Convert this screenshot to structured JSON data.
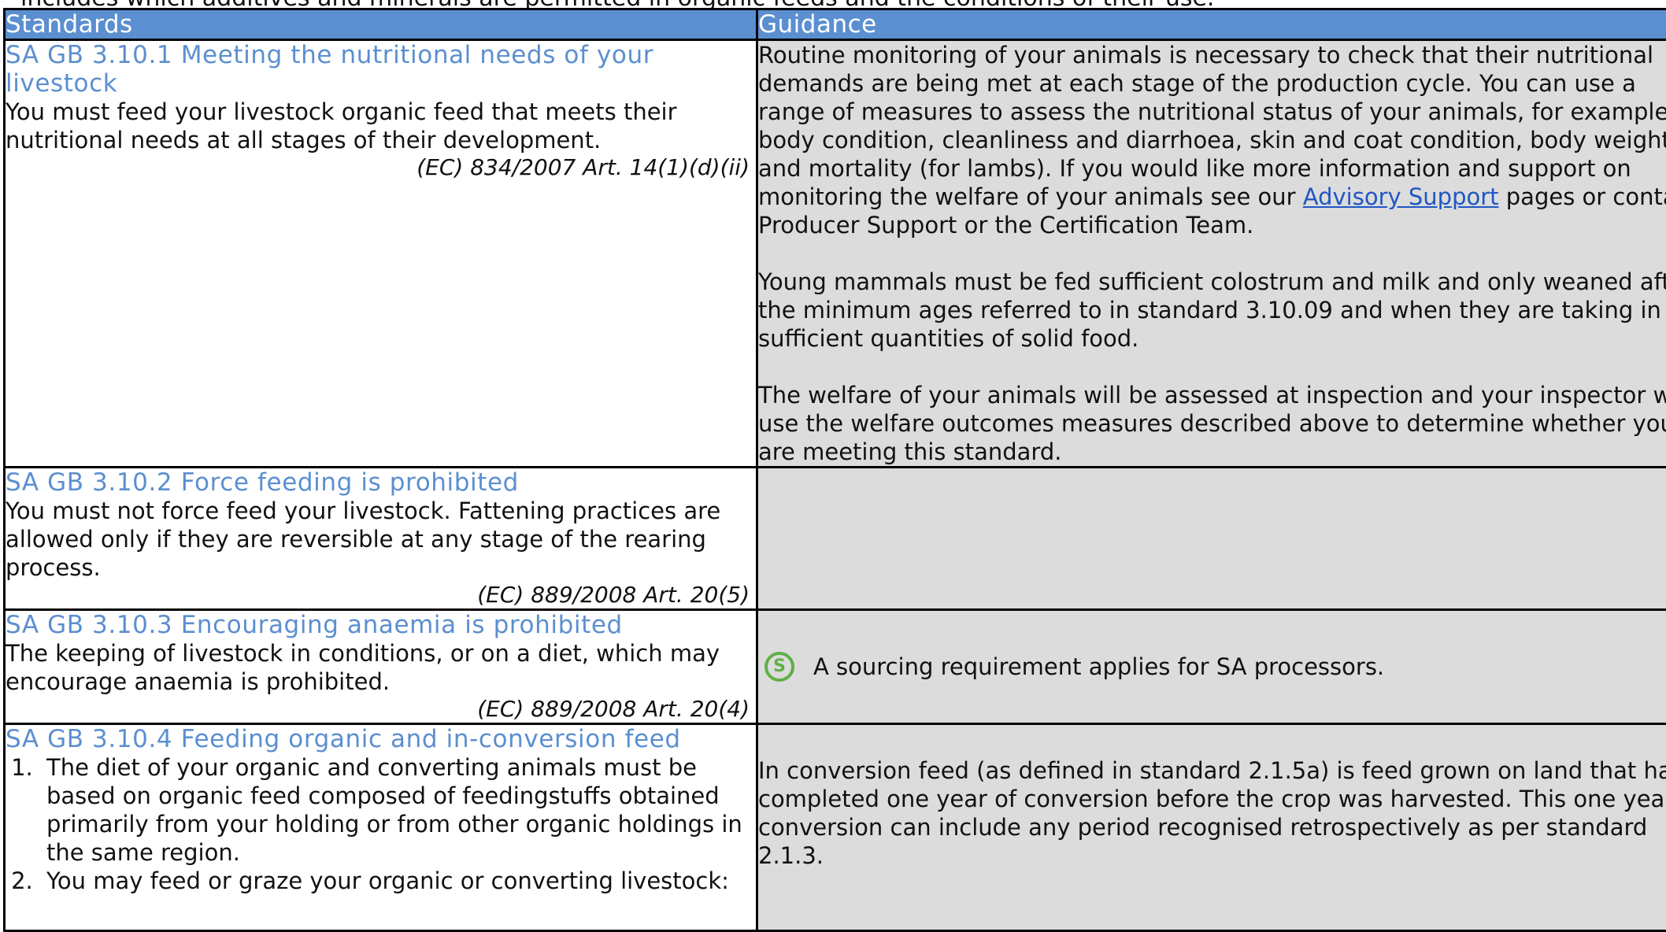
{
  "page": {
    "cut_off_line": "includes which additives and minerals are permitted in organic feeds and the conditions of their use."
  },
  "table": {
    "headers": {
      "standards": "Standards",
      "guidance": "Guidance"
    },
    "rows": [
      {
        "title": "SA GB 3.10.1 Meeting the nutritional needs of your livestock",
        "text": "You must feed your livestock organic feed that meets their nutritional needs at all stages of their development.",
        "reference": "(EC) 834/2007 Art. 14(1)(d)(ii)",
        "guidance": {
          "p1_start": "Routine monitoring of your animals is necessary to check that their nutritional demands are being met at each stage of the production cycle. You can use a range of measures to assess the nutritional status of your animals, for example, body condition, cleanliness and diarrhoea, skin and coat condition, body weight and mortality (for lambs). If you would like more information and support on monitoring the welfare of your animals see our",
          "p1_link": "Advisory Support",
          "p1_end": "pages or contact Producer Support or the Certification Team.",
          "p2": "Young mammals must be fed sufficient colostrum and milk and only weaned after the minimum ages referred to in standard 3.10.09 and when they are taking in sufficient quantities of solid food.",
          "p3": "The welfare of your animals will be assessed at inspection and your inspector will use the welfare outcomes measures described above to determine whether you are meeting this standard."
        }
      },
      {
        "title": "SA GB 3.10.2 Force feeding is prohibited",
        "text": "You must not force feed your livestock. Fattening practices are allowed only if they are reversible at any stage of the rearing process.",
        "reference": "(EC) 889/2008 Art. 20(5)"
      },
      {
        "title": "SA GB 3.10.3 Encouraging anaemia is prohibited",
        "text": "The keeping of livestock in conditions, or on a diet, which may encourage anaemia is prohibited.",
        "reference": "(EC) 889/2008 Art. 20(4)",
        "guidance": {
          "icon_letter": "S",
          "note": "A sourcing requirement applies for SA processors."
        }
      },
      {
        "title": "SA GB 3.10.4 Feeding organic and in-conversion feed",
        "items": [
          "The diet of your organic and converting animals must be based on organic feed composed of feedingstuffs obtained primarily from your holding or from other organic holdings in the same region.",
          "You may feed or graze your organic or converting livestock:"
        ],
        "guidance": {
          "p1": "In conversion feed (as defined in standard 2.1.5a) is feed grown on land that had completed one year of conversion before the crop was harvested. This one year of conversion can include any period recognised retrospectively as per standard 2.1.3."
        }
      }
    ]
  },
  "colors": {
    "header_bg": "#5b8fd0",
    "title_blue": "#5b8fd0",
    "guidance_bg": "#dcdcdc",
    "icon_green": "#5fb044",
    "link": "#1f57c4"
  }
}
